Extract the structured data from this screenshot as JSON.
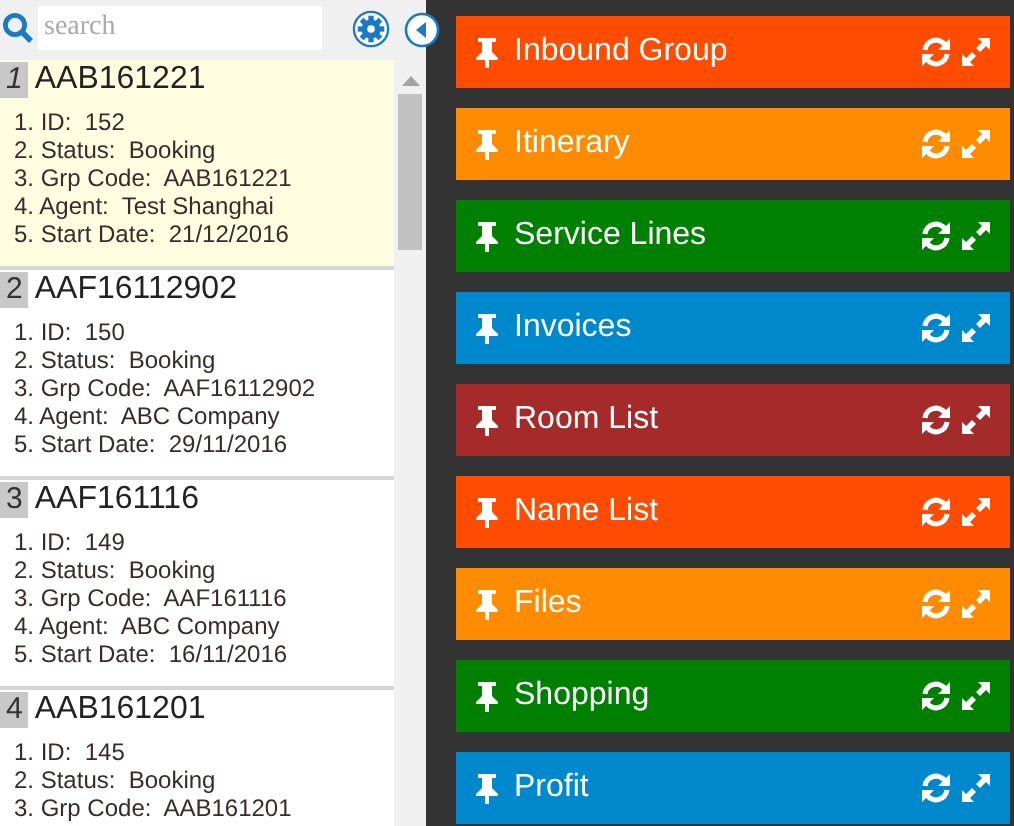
{
  "search": {
    "placeholder": "search"
  },
  "orders": [
    {
      "number": "1",
      "code": "AAB161221",
      "selected": true,
      "fields": [
        "1. ID:  152",
        "2. Status:  Booking",
        "3. Grp Code:  AAB161221",
        "4. Agent:  Test Shanghai",
        "5. Start Date:  21/12/2016"
      ]
    },
    {
      "number": "2",
      "code": "AAF16112902",
      "selected": false,
      "fields": [
        "1. ID:  150",
        "2. Status:  Booking",
        "3. Grp Code:  AAF16112902",
        "4. Agent:  ABC Company",
        "5. Start Date:  29/11/2016"
      ]
    },
    {
      "number": "3",
      "code": "AAF161116",
      "selected": false,
      "fields": [
        "1. ID:  149",
        "2. Status:  Booking",
        "3. Grp Code:  AAF161116",
        "4. Agent:  ABC Company",
        "5. Start Date:  16/11/2016"
      ]
    },
    {
      "number": "4",
      "code": "AAB161201",
      "selected": false,
      "fields": [
        "1. ID:  145",
        "2. Status:  Booking",
        "3. Grp Code:  AAB161201"
      ]
    }
  ],
  "panels": [
    {
      "title": "Inbound Group",
      "color": "#ff4c00"
    },
    {
      "title": "Itinerary",
      "color": "#ff8c00"
    },
    {
      "title": "Service Lines",
      "color": "#008000"
    },
    {
      "title": "Invoices",
      "color": "#0088cc"
    },
    {
      "title": "Room List",
      "color": "#a52a2a"
    },
    {
      "title": "Name List",
      "color": "#ff4c00"
    },
    {
      "title": "Files",
      "color": "#ff8c00"
    },
    {
      "title": "Shopping",
      "color": "#008000"
    },
    {
      "title": "Profit",
      "color": "#0088cc"
    }
  ]
}
